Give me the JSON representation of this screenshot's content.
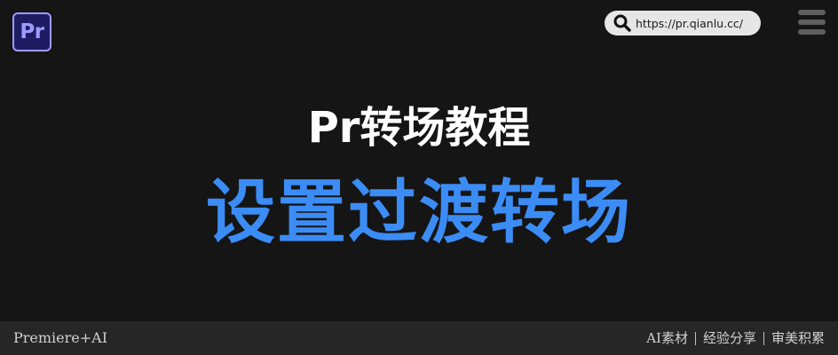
{
  "header": {
    "logo_text": "Pr",
    "url": "https://pr.qianlu.cc/",
    "brand_colors": {
      "logo_background": "#1f1c63",
      "logo_accent": "#9d9cff",
      "title_blue": "#3c8cf5"
    }
  },
  "main": {
    "subtitle": "Pr转场教程",
    "title": "设置过渡转场"
  },
  "footer": {
    "left_text": "Premiere+AI",
    "links": [
      "AI素材",
      "经验分享",
      "审美积累"
    ]
  },
  "icons": {
    "search": "search-icon",
    "menu": "hamburger-menu-icon"
  }
}
